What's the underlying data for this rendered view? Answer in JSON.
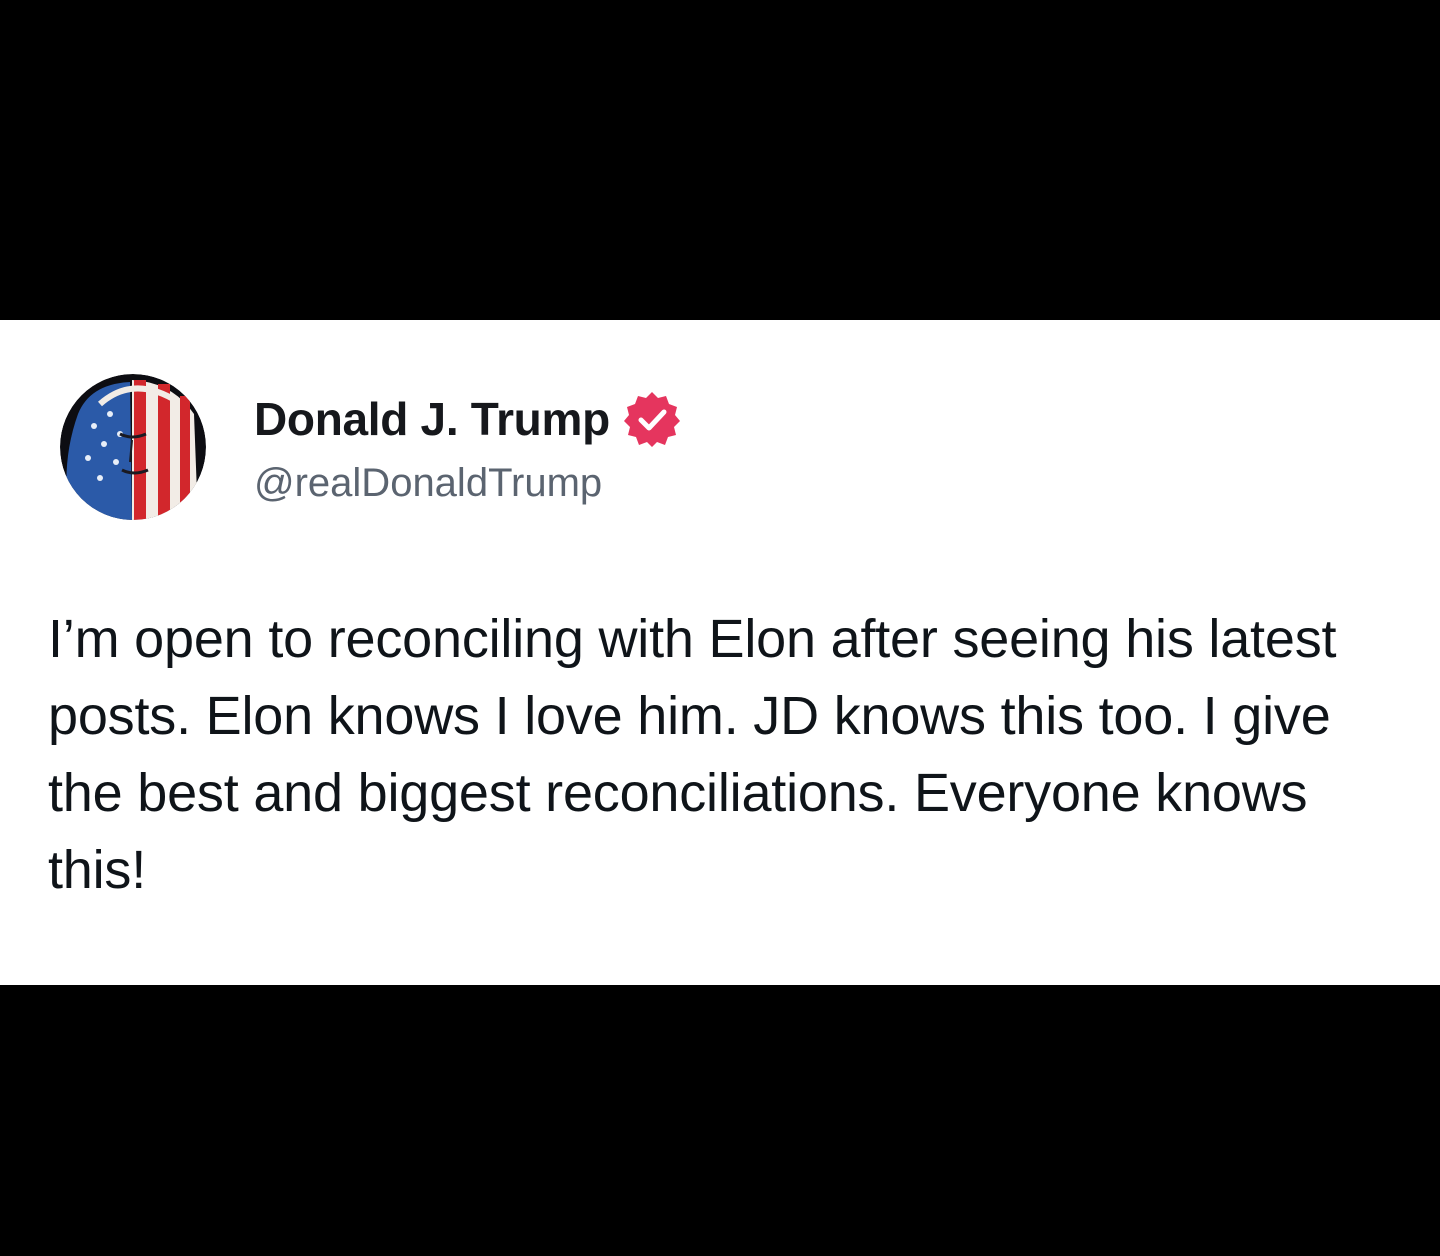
{
  "post": {
    "author": {
      "display_name": "Donald J. Trump",
      "handle": "@realDonaldTrump",
      "verified": true,
      "verified_icon": "verified-badge-icon",
      "verified_color": "#e5355e",
      "avatar_icon": "flag-portrait-avatar"
    },
    "text": "I’m open to reconciling with Elon after seeing his latest posts. Elon knows I love him. JD knows this too. I give the best and biggest reconciliations. Everyone knows this!"
  },
  "colors": {
    "background": "#000000",
    "card": "#ffffff",
    "name": "#16181c",
    "handle": "#5b6470",
    "body": "#0f1419"
  }
}
